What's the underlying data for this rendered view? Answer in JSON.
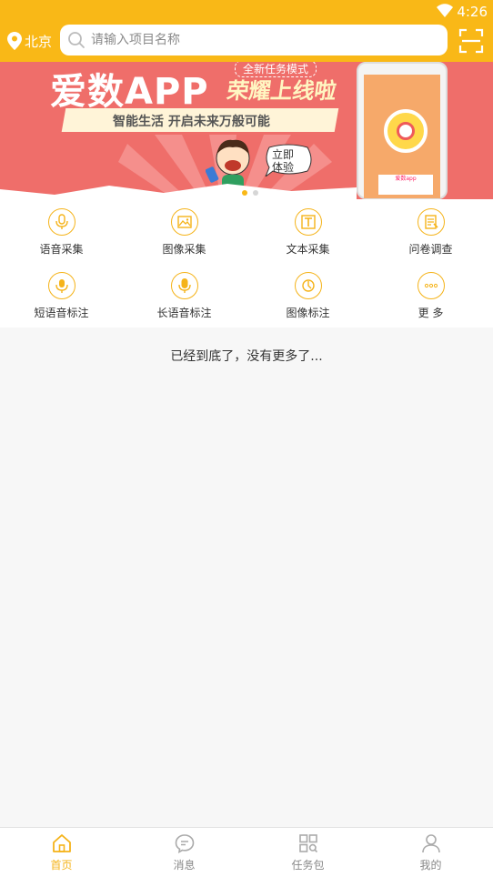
{
  "status_bar": {
    "time": "4:26",
    "icons": [
      "wifi-icon"
    ]
  },
  "header": {
    "city": "北京",
    "search_placeholder": "请输入项目名称",
    "icons": [
      "location-pin-icon",
      "search-icon",
      "scan-icon"
    ]
  },
  "banner": {
    "title": "爱数APP",
    "tag": "全新任务模式",
    "slogan": "荣耀上线啦",
    "tagline": "智能生活 开启未来万般可能",
    "bubble_line1": "立即",
    "bubble_line2": "体验",
    "phone_brand": "爱数app",
    "current_slide": 1,
    "slide_count": 2
  },
  "categories": [
    {
      "label": "语音采集",
      "icon": "microphone-icon"
    },
    {
      "label": "图像采集",
      "icon": "image-icon"
    },
    {
      "label": "文本采集",
      "icon": "text-icon"
    },
    {
      "label": "问卷调查",
      "icon": "questionnaire-icon"
    },
    {
      "label": "短语音标注",
      "icon": "short-voice-icon"
    },
    {
      "label": "长语音标注",
      "icon": "long-voice-icon"
    },
    {
      "label": "图像标注",
      "icon": "image-tag-icon"
    },
    {
      "label": "更 多",
      "icon": "more-icon"
    }
  ],
  "end_message": "已经到底了，没有更多了...",
  "tabbar": {
    "items": [
      {
        "label": "首页",
        "icon": "home-icon",
        "active": true
      },
      {
        "label": "消息",
        "icon": "message-icon",
        "active": false
      },
      {
        "label": "任务包",
        "icon": "task-package-icon",
        "active": false
      },
      {
        "label": "我的",
        "icon": "profile-icon",
        "active": false
      }
    ]
  },
  "colors": {
    "primary": "#f9b817",
    "banner_bg": "#ef6e6a",
    "icon_accent": "#f5b319",
    "tab_inactive": "#888888"
  }
}
